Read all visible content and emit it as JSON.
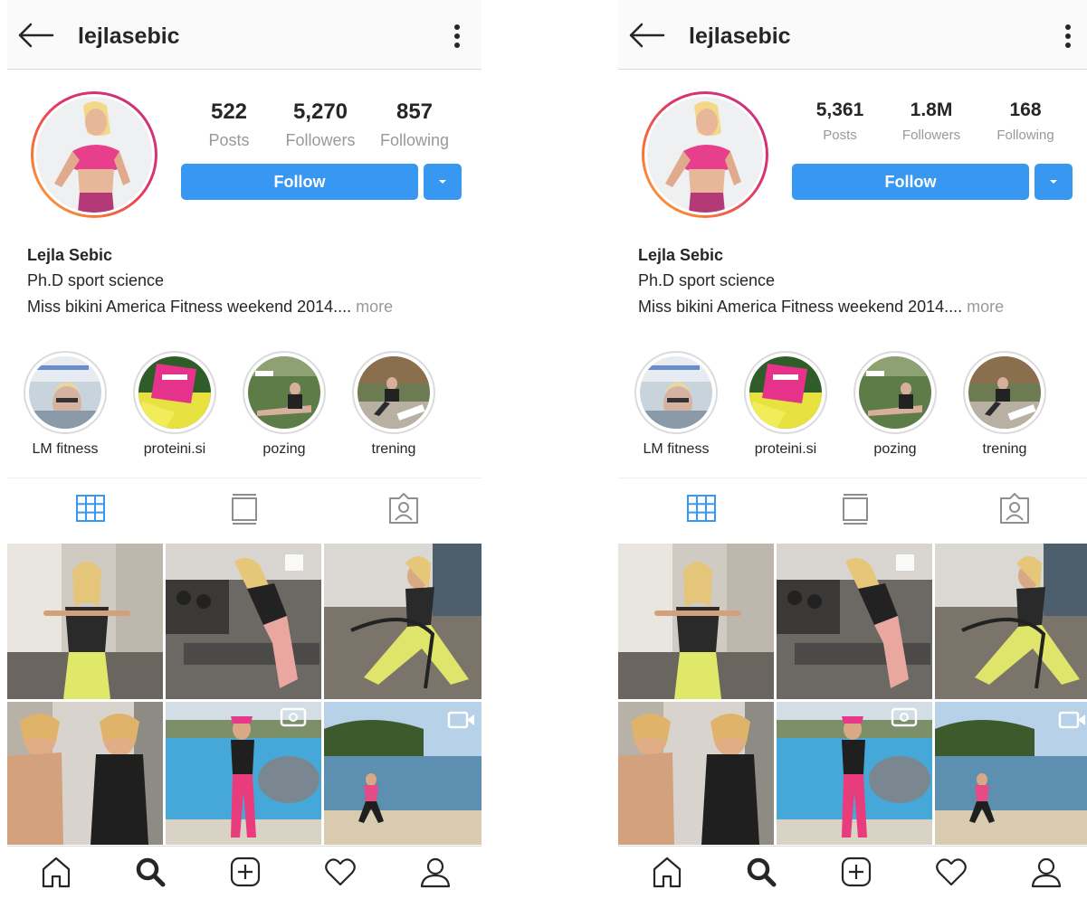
{
  "profiles": [
    {
      "username": "lejlasebic",
      "stats": [
        {
          "value": "522",
          "label": "Posts"
        },
        {
          "value": "5,270",
          "label": "Followers"
        },
        {
          "value": "857",
          "label": "Following"
        }
      ],
      "follow_label": "Follow",
      "name": "Lejla Sebic",
      "bio_line1": "Ph.D sport science",
      "bio_line2": "Miss bikini America Fitness weekend 2014....",
      "bio_more": " more",
      "highlights": [
        "LM fitness",
        "proteini.si",
        "pozing",
        "trening"
      ]
    },
    {
      "username": "lejlasebic",
      "stats": [
        {
          "value": "5,361",
          "label": "Posts"
        },
        {
          "value": "1.8M",
          "label": "Followers"
        },
        {
          "value": "168",
          "label": "Following"
        }
      ],
      "follow_label": "Follow",
      "name": "Lejla Sebic",
      "bio_line1": "Ph.D sport science",
      "bio_line2": "Miss bikini America Fitness weekend 2014....",
      "bio_more": " more",
      "highlights": [
        "LM fitness",
        "proteini.si",
        "pozing",
        "trening"
      ]
    }
  ],
  "icons": {
    "top": [
      "back-arrow-icon",
      "more-options-icon"
    ],
    "tabs": [
      "grid-view-icon",
      "feed-view-icon",
      "tagged-photos-icon"
    ],
    "bottom_nav": [
      "home-icon",
      "search-icon",
      "new-post-icon",
      "activity-heart-icon",
      "profile-icon"
    ]
  },
  "colors": {
    "accent": "#3897f0",
    "muted_text": "#999999",
    "story_ring": [
      "#c13584",
      "#e1306c",
      "#f77737",
      "#fcaf45"
    ]
  }
}
